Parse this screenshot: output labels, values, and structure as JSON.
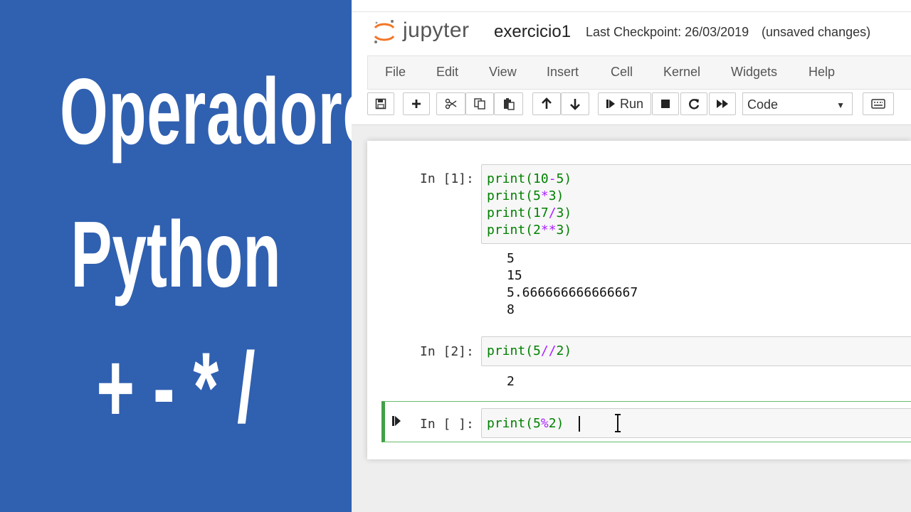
{
  "overlay": {
    "line1": "Operadores",
    "line2": "Python",
    "line3": "+ - * /",
    "background": "#3060b0"
  },
  "header": {
    "logo_text": "jupyter",
    "notebook_title": "exercicio1",
    "checkpoint": "Last Checkpoint: 26/03/2019",
    "status": "(unsaved changes)"
  },
  "menu": [
    "File",
    "Edit",
    "View",
    "Insert",
    "Cell",
    "Kernel",
    "Widgets",
    "Help"
  ],
  "toolbar": {
    "run_label": "Run",
    "cell_type": "Code",
    "icons": [
      "save-icon",
      "plus-icon",
      "scissors-icon",
      "copy-icon",
      "paste-icon",
      "arrow-up-icon",
      "arrow-down-icon",
      "step-run-icon",
      "stop-icon",
      "restart-icon",
      "fast-forward-icon",
      "keyboard-icon"
    ]
  },
  "cells": [
    {
      "prompt": "In [1]:",
      "code": [
        "print(10-5)",
        "print(5*3)",
        "print(17/3)",
        "print(2**3)"
      ],
      "output": [
        "5",
        "15",
        "5.666666666666667",
        "8"
      ]
    },
    {
      "prompt": "In [2]:",
      "code": [
        "print(5//2)"
      ],
      "output": [
        "2"
      ]
    },
    {
      "prompt": "In [ ]:",
      "code": [
        "print(5%2)"
      ],
      "output": []
    }
  ]
}
